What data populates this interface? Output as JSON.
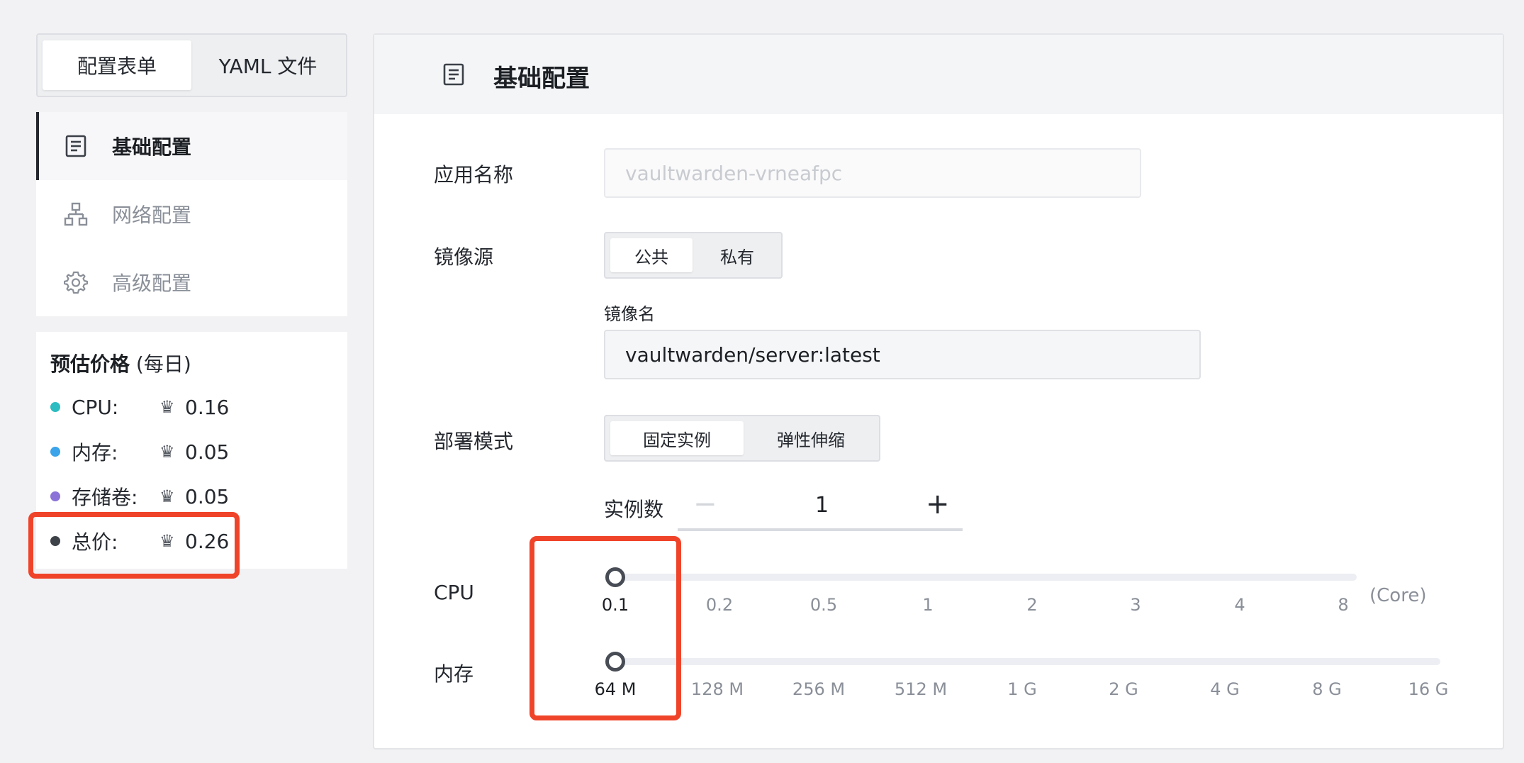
{
  "mode_switch": {
    "tabs": [
      "配置表单",
      "YAML 文件"
    ],
    "active": 0
  },
  "nav": {
    "items": [
      {
        "label": "基础配置",
        "icon": "document-icon",
        "active": true
      },
      {
        "label": "网络配置",
        "icon": "network-icon",
        "active": false
      },
      {
        "label": "高级配置",
        "icon": "gear-icon",
        "active": false
      }
    ]
  },
  "price": {
    "title": "预估价格",
    "title_suffix": "(每日)",
    "rows": [
      {
        "label": "CPU:",
        "value": "0.16",
        "color": "#2bbcc1"
      },
      {
        "label": "内存:",
        "value": "0.05",
        "color": "#3aa3e9"
      },
      {
        "label": "存储卷:",
        "value": "0.05",
        "color": "#8b72d9"
      },
      {
        "label": "总价:",
        "value": "0.26",
        "color": "#3d4249"
      }
    ]
  },
  "panel": {
    "title": "基础配置",
    "app_name": {
      "label": "应用名称",
      "placeholder": "vaultwarden-vrneafpc"
    },
    "image_source": {
      "label": "镜像源",
      "options": [
        "公共",
        "私有"
      ],
      "active": 0
    },
    "image_name": {
      "label": "镜像名",
      "value": "vaultwarden/server:latest"
    },
    "deploy_mode": {
      "label": "部署模式",
      "options": [
        "固定实例",
        "弹性伸缩"
      ],
      "active": 0
    },
    "instances": {
      "label": "实例数",
      "value": "1",
      "minus": "−",
      "plus": "+"
    },
    "cpu": {
      "label": "CPU",
      "ticks": [
        "0.1",
        "0.2",
        "0.5",
        "1",
        "2",
        "3",
        "4",
        "8"
      ],
      "selected_index": 0,
      "unit": "(Core)"
    },
    "memory": {
      "label": "内存",
      "ticks": [
        "64 M",
        "128 M",
        "256 M",
        "512 M",
        "1 G",
        "2 G",
        "4 G",
        "8 G",
        "16 G"
      ],
      "selected_index": 0
    }
  },
  "colors": {
    "highlight": "#f0442a",
    "accent": "#24282e"
  }
}
